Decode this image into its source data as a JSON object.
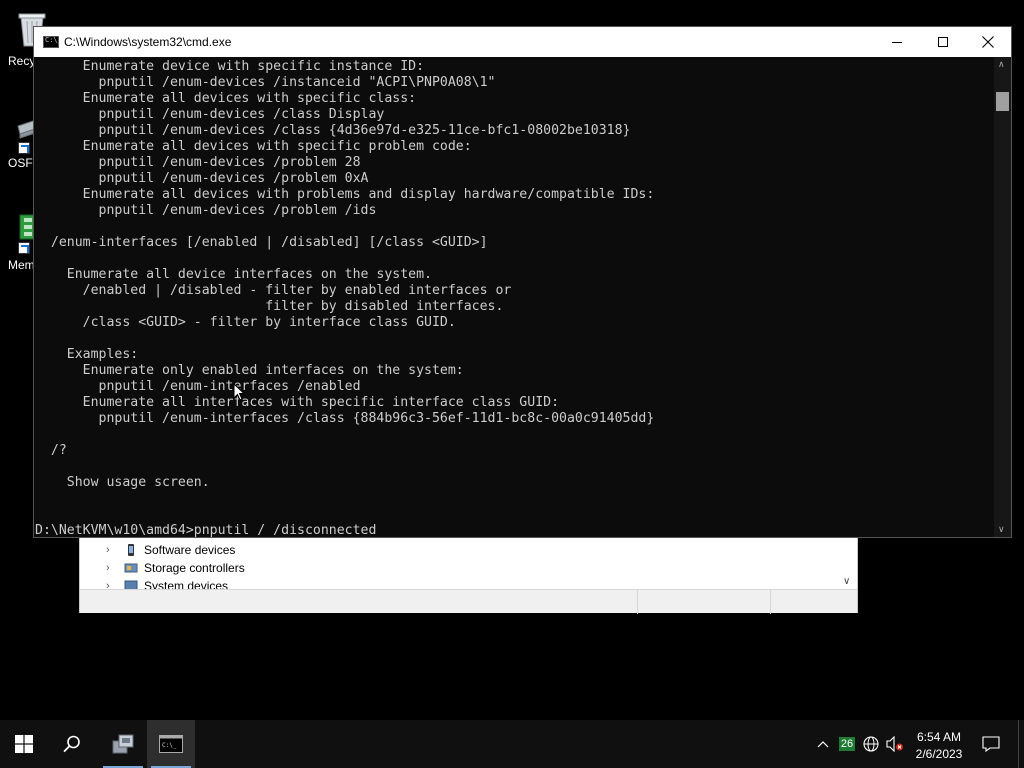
{
  "desktop": {
    "icons": [
      {
        "label": "Recy",
        "icon": "recycle-bin-icon"
      },
      {
        "label": "OSFI",
        "icon": "drive-shortcut-icon"
      },
      {
        "label": "Mem",
        "icon": "memory-shortcut-icon"
      }
    ]
  },
  "cmd": {
    "title": "C:\\Windows\\system32\\cmd.exe",
    "app_icon_text": "C:\\_",
    "lines": [
      "      Enumerate device with specific instance ID:",
      "        pnputil /enum-devices /instanceid \"ACPI\\PNP0A08\\1\"",
      "      Enumerate all devices with specific class:",
      "        pnputil /enum-devices /class Display",
      "        pnputil /enum-devices /class {4d36e97d-e325-11ce-bfc1-08002be10318}",
      "      Enumerate all devices with specific problem code:",
      "        pnputil /enum-devices /problem 28",
      "        pnputil /enum-devices /problem 0xA",
      "      Enumerate all devices with problems and display hardware/compatible IDs:",
      "        pnputil /enum-devices /problem /ids",
      "",
      "  /enum-interfaces [/enabled | /disabled] [/class <GUID>]",
      "",
      "    Enumerate all device interfaces on the system.",
      "      /enabled | /disabled - filter by enabled interfaces or",
      "                             filter by disabled interfaces.",
      "      /class <GUID> - filter by interface class GUID.",
      "",
      "    Examples:",
      "      Enumerate only enabled interfaces on the system:",
      "        pnputil /enum-interfaces /enabled",
      "      Enumerate all interfaces with specific interface class GUID:",
      "        pnputil /enum-interfaces /class {884b96c3-56ef-11d1-bc8c-00a0c91405dd}",
      "",
      "  /?",
      "",
      "    Show usage screen.",
      "",
      "",
      "D:\\NetKVM\\w10\\amd64>pnputil / /disconnected"
    ]
  },
  "devmgr": {
    "items": [
      {
        "label": "Software devices",
        "icon": "software-devices-icon"
      },
      {
        "label": "Storage controllers",
        "icon": "storage-controllers-icon"
      },
      {
        "label": "System devices",
        "icon": "system-devices-icon"
      }
    ]
  },
  "taskbar": {
    "tray_badge": "26",
    "time": "6:54 AM",
    "date": "2/6/2023"
  },
  "colors": {
    "console_bg": "#0c0c0c",
    "console_text": "#cccccc",
    "taskbar_bg": "#101010",
    "badge_green": "#1e7b34"
  }
}
